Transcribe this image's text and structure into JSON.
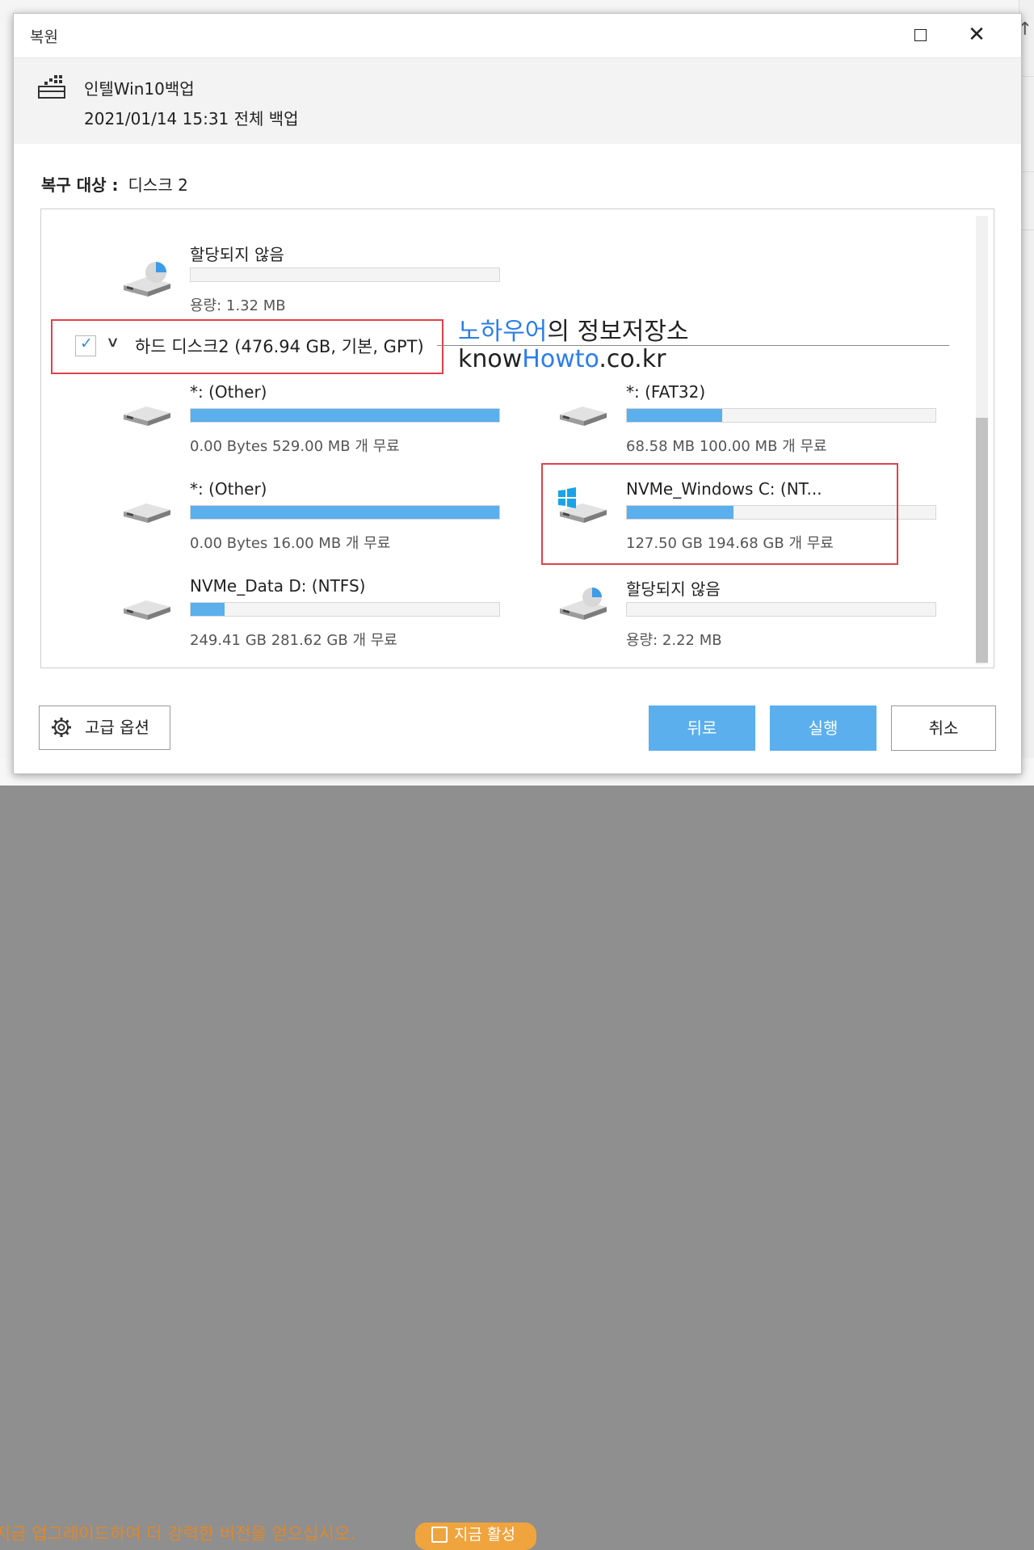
{
  "background": {
    "promo_text": "지금 업그레이드하여 더 강력한 버전을 얻으십시오.",
    "promo_button": "지금 활성",
    "promo_color": "#f0a43e"
  },
  "dialog": {
    "title": "복원",
    "backup_name": "인텔Win10백업",
    "backup_date": "2021/01/14 15:31 전체 백업",
    "target_label": "복구 대상 :",
    "target_value": "디스크 2"
  },
  "disk": {
    "label": "하드 디스크2 (476.94 GB, 기본, GPT)",
    "checked": true
  },
  "partitions": [
    {
      "name": "할당되지 않음",
      "size_text": "용량: 1.32 MB",
      "fill": 0,
      "icon": "unallocated-drive-icon"
    },
    {
      "name": "*: (Other)",
      "size_text": "0.00 Bytes 529.00 MB 개 무료",
      "fill": 1.0,
      "icon": "drive-icon"
    },
    {
      "name": "*: (FAT32)",
      "size_text": "68.58 MB 100.00 MB 개 무료",
      "fill": 0.31,
      "icon": "drive-icon"
    },
    {
      "name": "*: (Other)",
      "size_text": "0.00 Bytes 16.00 MB 개 무료",
      "fill": 1.0,
      "icon": "drive-icon"
    },
    {
      "name": "NVMe_Windows C: (NT...",
      "size_text": "127.50 GB 194.68 GB 개 무료",
      "fill": 0.345,
      "icon": "windows-drive-icon"
    },
    {
      "name": "NVMe_Data D: (NTFS)",
      "size_text": "249.41 GB 281.62 GB 개 무료",
      "fill": 0.11,
      "icon": "drive-icon"
    },
    {
      "name": "할당되지 않음",
      "size_text": "용량: 2.22 MB",
      "fill": 0,
      "icon": "unallocated-drive-icon"
    }
  ],
  "watermark": {
    "line1_blue": "노하우어",
    "line1_rest": "의 정보저장소",
    "line2_a": "know",
    "line2_blue": "Howto",
    "line2_b": ".co.kr"
  },
  "buttons": {
    "advanced": "고급 옵션",
    "back": "뒤로",
    "run": "실행",
    "cancel": "취소"
  },
  "colors": {
    "accent": "#5aafec",
    "highlight_box": "#e0424a",
    "watermark_blue": "#2b7ee8"
  }
}
